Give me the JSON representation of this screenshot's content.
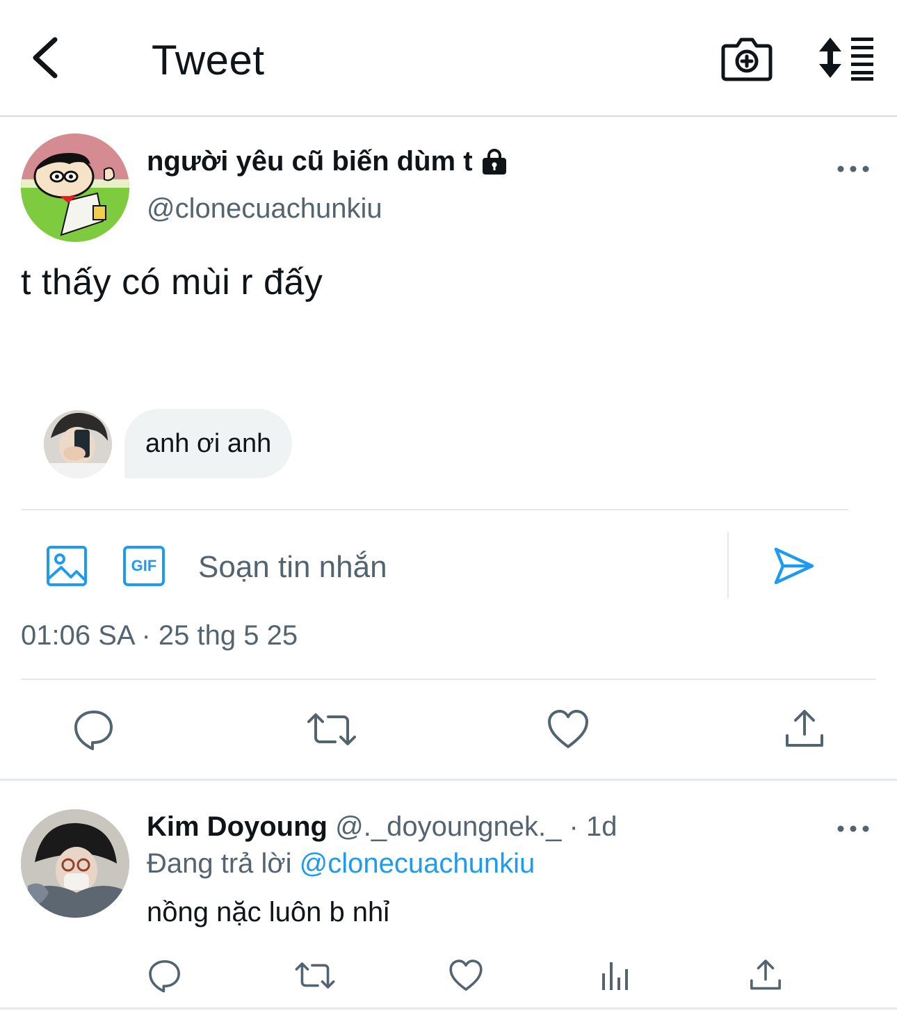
{
  "header": {
    "title": "Tweet",
    "back_icon": "chevron-left-icon",
    "camera_icon": "camera-plus-icon",
    "sort_icon": "sort-list-icon"
  },
  "tweet": {
    "display_name": "người yêu cũ biến dùm t",
    "handle": "@clonecuachunkiu",
    "protected": true,
    "text": "t thấy có mùi r đấy",
    "timestamp": "01:06 SA · 25 thg 5 25"
  },
  "dm_preview": {
    "message": "anh ơi anh"
  },
  "composer": {
    "placeholder": "Soạn tin nhắn",
    "image_icon": "image-icon",
    "gif_label": "GIF",
    "send_icon": "send-icon"
  },
  "actions": [
    "reply-icon",
    "retweet-icon",
    "like-icon",
    "share-icon"
  ],
  "reply": {
    "display_name": "Kim Doyoung",
    "handle_time": "@._doyoungnek._ · 1d",
    "replying_prefix": "Đang trả lời",
    "replying_handle": "@clonecuachunkiu",
    "text": "nồng nặc luôn b nhỉ",
    "actions": [
      "reply-icon",
      "retweet-icon",
      "like-icon",
      "views-icon",
      "share-icon"
    ]
  },
  "colors": {
    "text": "#0f1419",
    "secondary": "#536471",
    "accent": "#1d9bf0",
    "divider": "#e6e9eb",
    "bubble": "#eff3f4"
  }
}
